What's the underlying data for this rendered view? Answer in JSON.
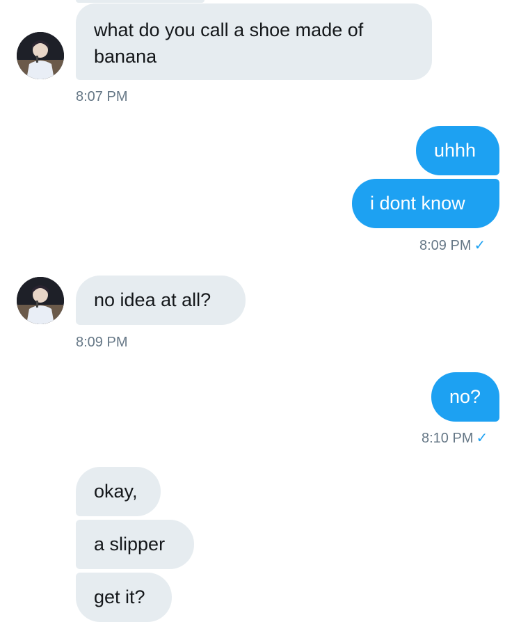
{
  "messages": {
    "m1": {
      "text": "what do you call a shoe made of\nbanana",
      "time": "8:07 PM"
    },
    "m2": {
      "text": "uhhh"
    },
    "m3": {
      "text": "i dont know",
      "time": "8:09 PM",
      "status": "✓"
    },
    "m4": {
      "text": "no idea at all?",
      "time": "8:09 PM"
    },
    "m5": {
      "text": "no?",
      "time": "8:10 PM",
      "status": "✓"
    },
    "m6": {
      "text": "okay,"
    },
    "m7": {
      "text": "a slipper"
    },
    "m8": {
      "text": "get it?"
    }
  },
  "colors": {
    "sent_bubble": "#1da1f2",
    "received_bubble": "#e6ecf0",
    "timestamp": "#657786",
    "read_check": "#1da1f2"
  },
  "icons": {
    "avatar": "contact-avatar-photo",
    "status": "check-icon"
  }
}
